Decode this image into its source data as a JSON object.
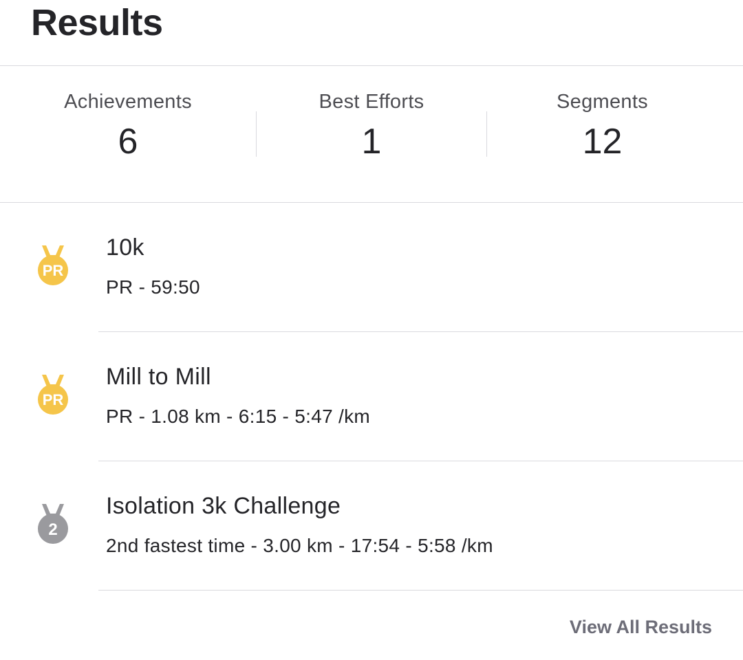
{
  "page": {
    "title": "Results"
  },
  "stats": [
    {
      "label": "Achievements",
      "value": "6"
    },
    {
      "label": "Best Efforts",
      "value": "1"
    },
    {
      "label": "Segments",
      "value": "12"
    }
  ],
  "results": [
    {
      "title": "10k",
      "detail": "PR - 59:50",
      "badge": {
        "icon": "pr-medal-icon",
        "text": "PR",
        "color": "#f5c54a",
        "ribbon": "#e8b53a"
      }
    },
    {
      "title": "Mill to Mill",
      "detail": "PR - 1.08 km - 6:15 - 5:47 /km",
      "badge": {
        "icon": "pr-medal-icon",
        "text": "PR",
        "color": "#f5c54a",
        "ribbon": "#e8b53a"
      }
    },
    {
      "title": "Isolation 3k Challenge",
      "detail": "2nd fastest time - 3.00 km - 17:54 - 5:58 /km",
      "badge": {
        "icon": "second-place-medal-icon",
        "text": "2",
        "color": "#9a9a9e",
        "ribbon": "#8a8a8e"
      }
    }
  ],
  "footer": {
    "view_all_label": "View All Results"
  }
}
